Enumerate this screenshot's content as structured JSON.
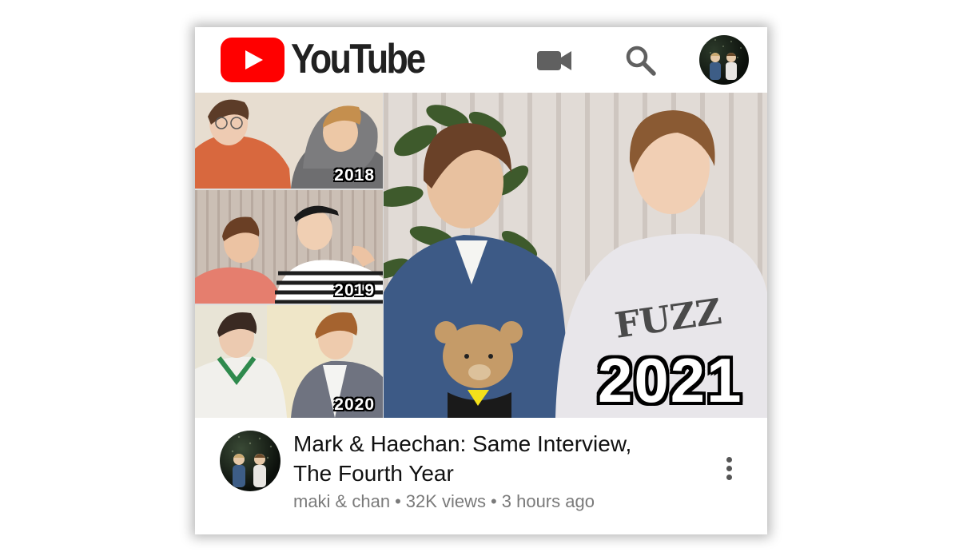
{
  "header": {
    "logo_text": "YouTube",
    "brand_color": "#ff0000",
    "icons": [
      "youtube-play-icon",
      "camera-icon",
      "search-icon",
      "account-avatar"
    ]
  },
  "thumbnail": {
    "panels": [
      {
        "year": "2018"
      },
      {
        "year": "2019"
      },
      {
        "year": "2020"
      },
      {
        "year": "2021"
      }
    ]
  },
  "video": {
    "title_line1": "Mark & Haechan: Same Interview,",
    "title_line2": "The Fourth Year",
    "channel": "maki & chan",
    "views": "32K views",
    "age": "3 hours ago",
    "separator": "•"
  }
}
